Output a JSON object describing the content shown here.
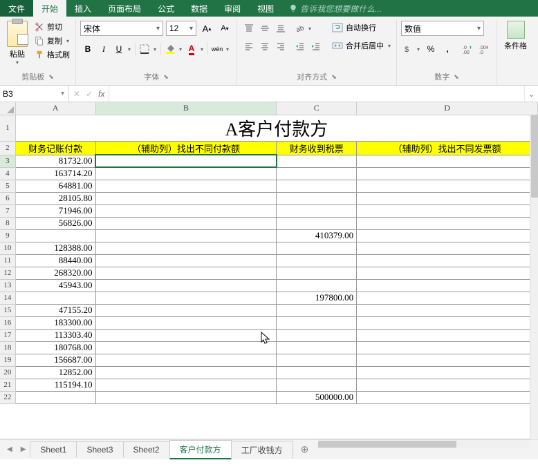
{
  "tabs": {
    "file": "文件",
    "home": "开始",
    "insert": "插入",
    "page_layout": "页面布局",
    "formulas": "公式",
    "data": "数据",
    "review": "审阅",
    "view": "视图",
    "hint": "告诉我您想要做什么..."
  },
  "ribbon": {
    "clipboard": {
      "paste": "粘贴",
      "cut": "剪切",
      "copy": "复制",
      "format_painter": "格式刷",
      "label": "剪贴板"
    },
    "font": {
      "name": "宋体",
      "size": "12",
      "bold": "B",
      "italic": "I",
      "underline": "U",
      "label": "字体",
      "wen": "wén"
    },
    "align": {
      "wrap": "自动换行",
      "merge": "合并后居中",
      "label": "对齐方式"
    },
    "number": {
      "format": "数值",
      "percent": "%",
      "comma": ",",
      "label": "数字"
    },
    "styles": {
      "cond_fmt": "条件格"
    }
  },
  "namebox": "B3",
  "columns": {
    "A": "A",
    "B": "B",
    "C": "C",
    "D": "D"
  },
  "headers": {
    "title": "A客户付款方",
    "colA": "财务记账付款",
    "colB": "（辅助列）找出不同付款额",
    "colC": "财务收到税票",
    "colD": "（辅助列）找出不同发票额"
  },
  "rows": [
    {
      "n": "3",
      "a": "81732.00",
      "c": ""
    },
    {
      "n": "4",
      "a": "163714.20",
      "c": ""
    },
    {
      "n": "5",
      "a": "64881.00",
      "c": ""
    },
    {
      "n": "6",
      "a": "28105.80",
      "c": ""
    },
    {
      "n": "7",
      "a": "71946.00",
      "c": ""
    },
    {
      "n": "8",
      "a": "56826.00",
      "c": ""
    },
    {
      "n": "9",
      "a": "",
      "c": "410379.00"
    },
    {
      "n": "10",
      "a": "128388.00",
      "c": ""
    },
    {
      "n": "11",
      "a": "88440.00",
      "c": ""
    },
    {
      "n": "12",
      "a": "268320.00",
      "c": ""
    },
    {
      "n": "13",
      "a": "45943.00",
      "c": ""
    },
    {
      "n": "14",
      "a": "",
      "c": "197800.00"
    },
    {
      "n": "15",
      "a": "47155.20",
      "c": ""
    },
    {
      "n": "16",
      "a": "183300.00",
      "c": ""
    },
    {
      "n": "17",
      "a": "113303.40",
      "c": ""
    },
    {
      "n": "18",
      "a": "180768.00",
      "c": ""
    },
    {
      "n": "19",
      "a": "156687.00",
      "c": ""
    },
    {
      "n": "20",
      "a": "12852.00",
      "c": ""
    },
    {
      "n": "21",
      "a": "115194.10",
      "c": ""
    },
    {
      "n": "22",
      "a": "",
      "c": "500000.00"
    }
  ],
  "sheets": {
    "s1": "Sheet1",
    "s3": "Sheet3",
    "s2": "Sheet2",
    "s4": "客户付款方",
    "s5": "工厂收钱方"
  }
}
